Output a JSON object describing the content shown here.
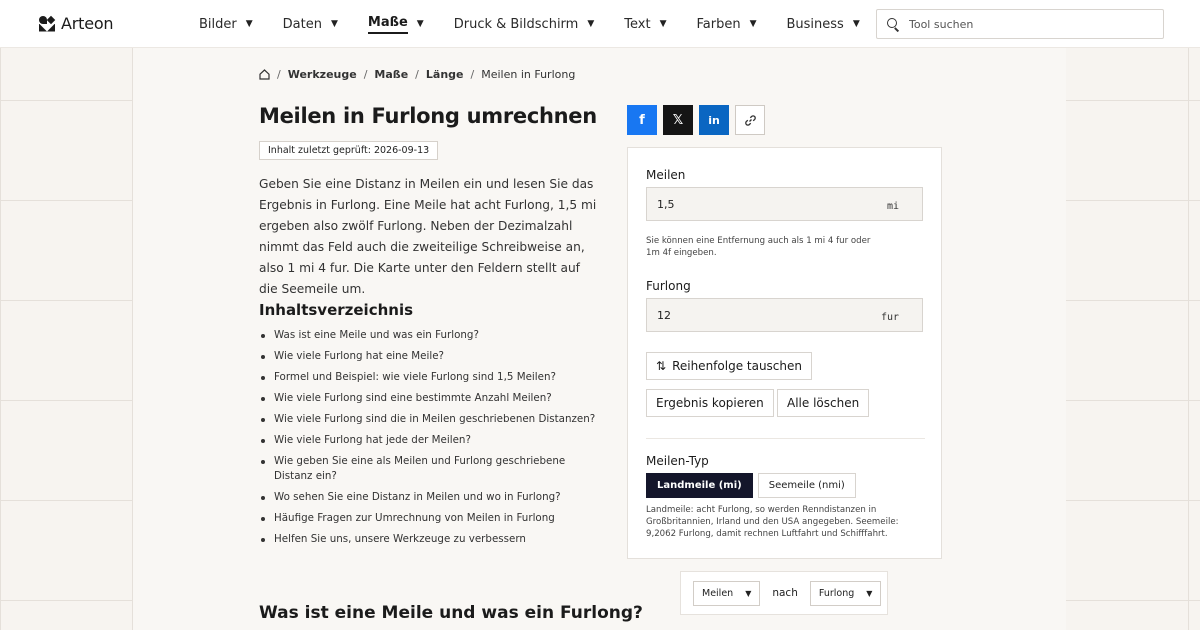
{
  "brand": {
    "name": "Arteon"
  },
  "nav": {
    "items": [
      {
        "label": "Bilder"
      },
      {
        "label": "Daten"
      },
      {
        "label": "Maße"
      },
      {
        "label": "Druck & Bildschirm"
      },
      {
        "label": "Text"
      },
      {
        "label": "Farben"
      },
      {
        "label": "Business"
      }
    ],
    "active_index": 2
  },
  "search": {
    "placeholder": "Tool suchen"
  },
  "breadcrumb": {
    "items": [
      "Werkzeuge",
      "Maße",
      "Länge"
    ],
    "current": "Meilen in Furlong"
  },
  "page": {
    "title": "Meilen in Furlong umrechnen",
    "review_badge": "Inhalt zuletzt geprüft: 2026-09-13",
    "intro": "Geben Sie eine Distanz in Meilen ein und lesen Sie das Ergebnis in Furlong. Eine Meile hat acht Furlong, 1,5 mi ergeben also zwölf Furlong. Neben der Dezimalzahl nimmt das Feld auch die zweiteilige Schreibweise an, also 1 mi 4 fur. Die Karte unter den Feldern stellt auf die Seemeile um.",
    "toc_title": "Inhaltsverzeichnis",
    "toc": [
      "Was ist eine Meile und was ein Furlong?",
      "Wie viele Furlong hat eine Meile?",
      "Formel und Beispiel: wie viele Furlong sind 1,5 Meilen?",
      "Wie viele Furlong sind eine bestimmte Anzahl Meilen?",
      "Wie viele Furlong sind die in Meilen geschriebenen Distanzen?",
      "Wie viele Furlong hat jede der Meilen?",
      "Wie geben Sie eine als Meilen und Furlong geschriebene Distanz ein?",
      "Wo sehen Sie eine Distanz in Meilen und wo in Furlong?",
      "Häufige Fragen zur Umrechnung von Meilen in Furlong",
      "Helfen Sie uns, unsere Werkzeuge zu verbessern"
    ],
    "section_heading": "Was ist eine Meile und was ein Furlong?"
  },
  "share": {
    "facebook": "f",
    "x": "𝕏",
    "linkedin": "in",
    "link": "🔗"
  },
  "converter": {
    "from_label": "Meilen",
    "from_value": "1,5",
    "from_unit": "mi",
    "hint": "Sie können eine Entfernung auch als 1 mi 4 fur oder 1m 4f eingeben.",
    "to_label": "Furlong",
    "to_value": "12",
    "to_unit": "fur",
    "swap_label": "Reihenfolge tauschen",
    "copy_label": "Ergebnis kopieren",
    "clear_label": "Alle löschen",
    "type_label": "Meilen-Typ",
    "type_options": [
      "Landmeile (mi)",
      "Seemeile (nmi)"
    ],
    "type_selected": 0,
    "type_note": "Landmeile: acht Furlong, so werden Renndistanzen in Großbritannien, Irland und den USA angegeben. Seemeile: 9,2062 Furlong, damit rechnen Luftfahrt und Schifffahrt."
  },
  "fromto": {
    "from": "Meilen",
    "connector": "nach",
    "to": "Furlong"
  }
}
